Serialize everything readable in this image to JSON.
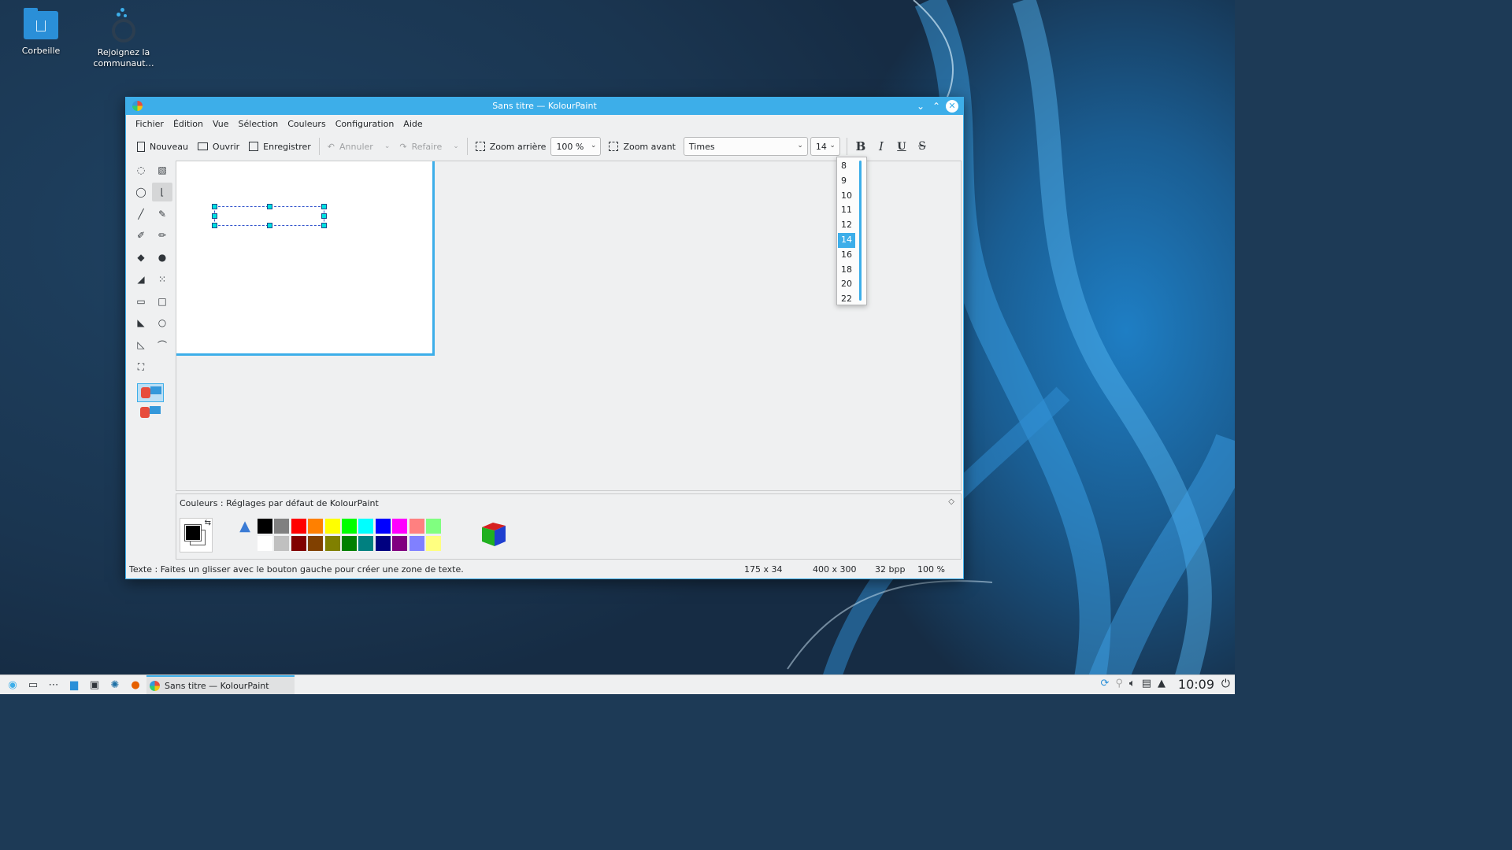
{
  "desktop": {
    "icons": [
      {
        "label": "Corbeille"
      },
      {
        "label": "Rejoignez la communaut…"
      }
    ]
  },
  "window": {
    "title": "Sans titre — KolourPaint"
  },
  "menu": [
    "Fichier",
    "Édition",
    "Vue",
    "Sélection",
    "Couleurs",
    "Configuration",
    "Aide"
  ],
  "toolbar": {
    "new_label": "Nouveau",
    "open_label": "Ouvrir",
    "save_label": "Enregistrer",
    "undo_label": "Annuler",
    "redo_label": "Refaire",
    "zoom_out_label": "Zoom arrière",
    "zoom_value": "100 %",
    "zoom_in_label": "Zoom avant",
    "font_family": "Times",
    "font_size": "14",
    "bold_label": "B",
    "italic_label": "I",
    "underline_label": "U",
    "strike_label": "S"
  },
  "font_size_options": [
    "8",
    "9",
    "10",
    "11",
    "12",
    "14",
    "16",
    "18",
    "20",
    "22"
  ],
  "font_size_selected": "14",
  "colors_panel": {
    "title": "Couleurs : Réglages par défaut de KolourPaint",
    "row1": [
      "#000000",
      "#808080",
      "#ff0000",
      "#ff8000",
      "#ffff00",
      "#00ff00",
      "#00ffff",
      "#0000ff",
      "#ff00ff",
      "#ff8080",
      "#80ff80"
    ],
    "row2": [
      "#ffffff",
      "#c0c0c0",
      "#800000",
      "#804000",
      "#808000",
      "#008000",
      "#008080",
      "#000080",
      "#800080",
      "#8080ff",
      "#ffff80"
    ]
  },
  "status": {
    "message": "Texte : Faites un glisser avec le bouton gauche pour créer une zone de texte.",
    "selection_size": "175 x 34",
    "image_size": "400 x 300",
    "depth": "32 bpp",
    "zoom": "100 %"
  },
  "taskbar": {
    "task_label": "Sans titre — KolourPaint",
    "clock": "10:09"
  }
}
